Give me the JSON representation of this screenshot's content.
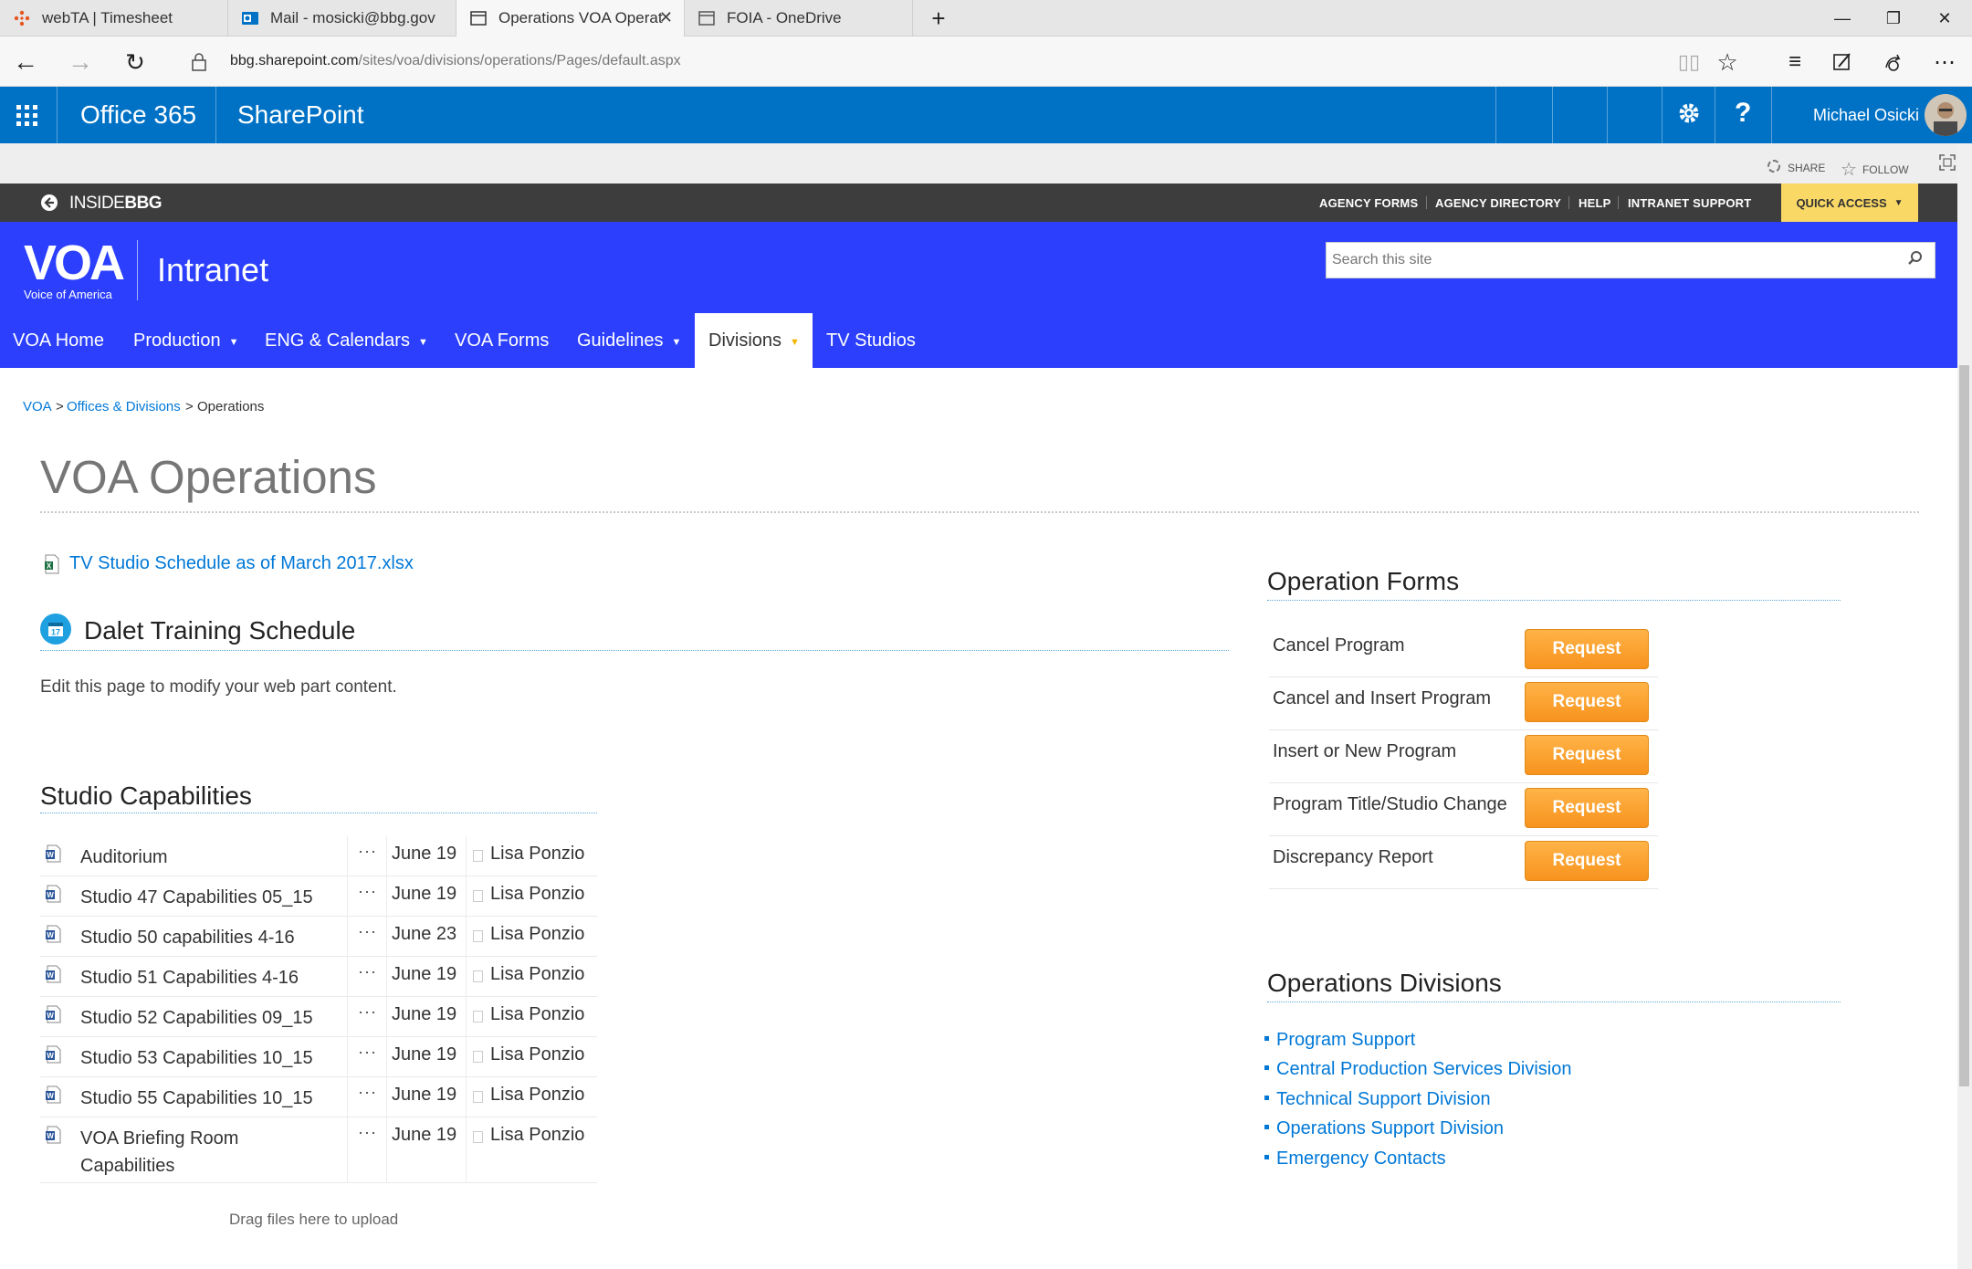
{
  "browser": {
    "tabs": [
      {
        "label": "webTA | Timesheet",
        "icon": "webta-icon"
      },
      {
        "label": "Mail - mosicki@bbg.gov",
        "icon": "outlook-icon"
      },
      {
        "label": "Operations VOA Operat",
        "icon": "page-icon",
        "active": true
      },
      {
        "label": "FOIA - OneDrive",
        "icon": "page-icon"
      }
    ],
    "new_tab": "+",
    "url_host": "bbg.sharepoint.com",
    "url_path": "/sites/voa/divisions/operations/Pages/default.aspx"
  },
  "suitebar": {
    "app_name": "Office 365",
    "product": "SharePoint",
    "user_name": "Michael Osicki",
    "help": "?"
  },
  "ribbon": {
    "share": "SHARE",
    "follow": "FOLLOW"
  },
  "bbgbar": {
    "back_label": "INSIDE",
    "logo_text": "BBG",
    "links": [
      "AGENCY FORMS",
      "AGENCY DIRECTORY",
      "HELP",
      "INTRANET SUPPORT"
    ],
    "quick_access": "QUICK ACCESS"
  },
  "voa": {
    "logo_text": "VOA",
    "logo_sub": "Voice of America",
    "site_name": "Intranet",
    "search_placeholder": "Search this site",
    "nav": [
      {
        "label": "VOA Home",
        "dropdown": false
      },
      {
        "label": "Production",
        "dropdown": true
      },
      {
        "label": "ENG & Calendars",
        "dropdown": true
      },
      {
        "label": "VOA Forms",
        "dropdown": false
      },
      {
        "label": "Guidelines",
        "dropdown": true
      },
      {
        "label": "Divisions",
        "dropdown": true,
        "active": true
      },
      {
        "label": "TV Studios",
        "dropdown": false
      }
    ]
  },
  "breadcrumb": {
    "items": [
      "VOA",
      "Offices & Divisions",
      "Operations"
    ],
    "separator": ">"
  },
  "page_title": "VOA Operations",
  "file_link": "TV Studio Schedule as of March 2017.xlsx",
  "dalet": {
    "title": "Dalet Training Schedule",
    "calendar_day": "17",
    "body": "Edit this page to modify your web part content."
  },
  "studio": {
    "title": "Studio Capabilities",
    "ellipsis": "···",
    "files": [
      {
        "name": "Auditorium",
        "date": "June 19",
        "author": "Lisa Ponzio"
      },
      {
        "name": "Studio 47 Capabilities 05_15",
        "date": "June 19",
        "author": "Lisa Ponzio"
      },
      {
        "name": "Studio 50 capabilities 4-16",
        "date": "June 23",
        "author": "Lisa Ponzio"
      },
      {
        "name": "Studio 51 Capabilities 4-16",
        "date": "June 19",
        "author": "Lisa Ponzio"
      },
      {
        "name": "Studio 52 Capabilities 09_15",
        "date": "June 19",
        "author": "Lisa Ponzio"
      },
      {
        "name": "Studio 53 Capabilities 10_15",
        "date": "June 19",
        "author": "Lisa Ponzio"
      },
      {
        "name": "Studio 55 Capabilities 10_15",
        "date": "June 19",
        "author": "Lisa Ponzio"
      },
      {
        "name_line1": "VOA Briefing Room",
        "name_line2": "Capabilities",
        "date": "June 19",
        "author": "Lisa Ponzio"
      }
    ],
    "drag_text": "Drag files here to upload"
  },
  "operation_forms": {
    "title": "Operation Forms",
    "button_label": "Request",
    "rows": [
      "Cancel Program",
      "Cancel and Insert Program",
      "Insert or New Program",
      "Program Title/Studio Change",
      "Discrepancy Report"
    ]
  },
  "operations_divisions": {
    "title": "Operations Divisions",
    "links": [
      "Program Support",
      "Central Production Services Division",
      "Technical Support Division",
      "Operations Support Division",
      "Emergency Contacts"
    ]
  },
  "colors": {
    "suite_blue": "#0072c6",
    "voa_blue": "#2b3ffd",
    "bbg_bar": "#3d3d3d",
    "quick_access": "#f9d866",
    "request_orange": "#f7931e",
    "link_blue": "#0078d7"
  }
}
